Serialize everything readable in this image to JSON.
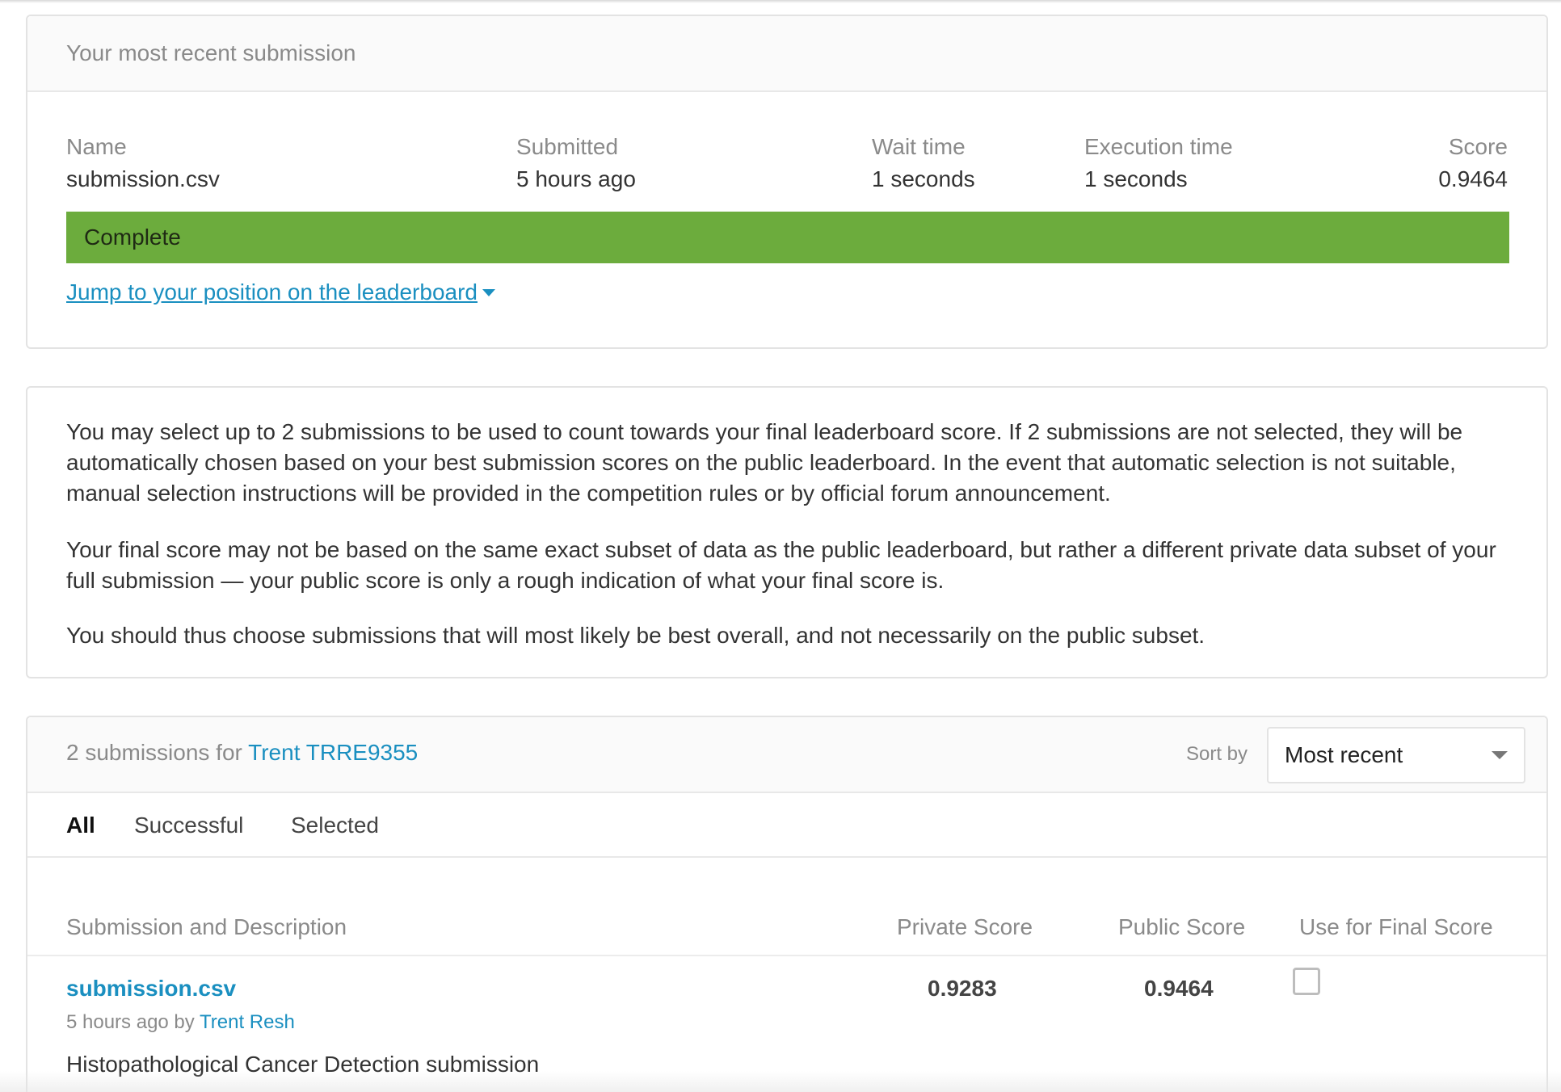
{
  "recent_submission": {
    "header": "Your most recent submission",
    "labels": {
      "name": "Name",
      "submitted": "Submitted",
      "wait_time": "Wait time",
      "execution_time": "Execution time",
      "score": "Score"
    },
    "values": {
      "name": "submission.csv",
      "submitted": "5 hours ago",
      "wait_time": "1 seconds",
      "execution_time": "1 seconds",
      "score": "0.9464"
    },
    "status": "Complete",
    "status_color": "#6cac3d",
    "jump_link": "Jump to your position on the leaderboard"
  },
  "info": {
    "paragraphs": [
      "You may select up to 2 submissions to be used to count towards your final leaderboard score. If 2 submissions are not selected, they will be automatically chosen based on your best submission scores on the public leaderboard. In the event that automatic selection is not suitable, manual selection instructions will be provided in the competition rules or by official forum announcement.",
      "Your final score may not be based on the same exact subset of data as the public leaderboard, but rather a different private data subset of your full submission — your public score is only a rough indication of what your final score is.",
      "You should thus choose submissions that will most likely be best overall, and not necessarily on the public subset."
    ]
  },
  "submissions": {
    "title_prefix": "2 submissions for",
    "user": "Trent TRRE9355",
    "sort_label": "Sort by",
    "sort_value": "Most recent",
    "tabs": [
      {
        "label": "All",
        "active": true
      },
      {
        "label": "Successful",
        "active": false
      },
      {
        "label": "Selected",
        "active": false
      }
    ],
    "columns": {
      "description": "Submission and Description",
      "private": "Private Score",
      "public": "Public Score",
      "final": "Use for Final Score"
    },
    "rows": [
      {
        "file": "submission.csv",
        "meta_prefix": "5 hours ago by",
        "author": "Trent Resh",
        "description": "Histopathological Cancer Detection submission",
        "private_score": "0.9283",
        "public_score": "0.9464",
        "use_for_final": false
      }
    ]
  },
  "colors": {
    "link": "#1a8fc0",
    "complete": "#6cac3d"
  }
}
